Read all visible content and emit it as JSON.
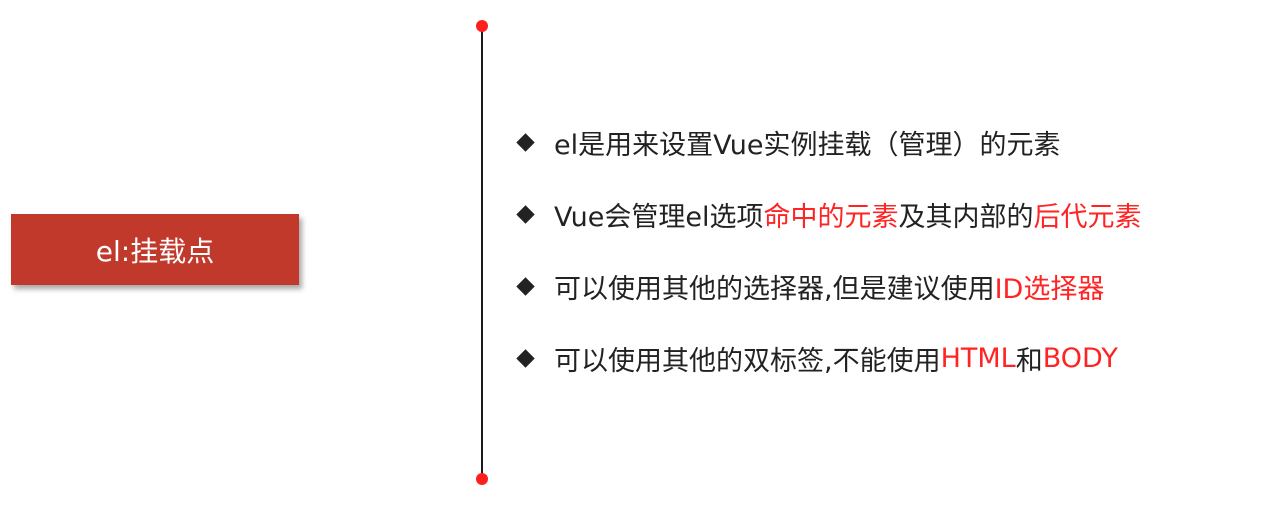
{
  "slide": {
    "title": "el:挂载点",
    "bullets": [
      {
        "parts": [
          {
            "text": "el是用来设置Vue实例挂载（管理）的元素",
            "highlight": false
          }
        ]
      },
      {
        "parts": [
          {
            "text": "Vue会管理el选项",
            "highlight": false
          },
          {
            "text": "命中的元素",
            "highlight": true
          },
          {
            "text": "及其内部的",
            "highlight": false
          },
          {
            "text": "后代元素",
            "highlight": true
          }
        ]
      },
      {
        "parts": [
          {
            "text": "可以使用其他的选择器,但是建议使用",
            "highlight": false
          },
          {
            "text": "ID选择器",
            "highlight": true
          }
        ]
      },
      {
        "parts": [
          {
            "text": "可以使用其他的双标签,不能使用",
            "highlight": false
          },
          {
            "text": "HTML",
            "highlight": true
          },
          {
            "text": "和",
            "highlight": false
          },
          {
            "text": "BODY",
            "highlight": true
          }
        ]
      }
    ]
  },
  "colors": {
    "title_bg": "#c0392b",
    "highlight": "#ff2323",
    "dot": "#ff1f1f",
    "text": "#222222"
  }
}
